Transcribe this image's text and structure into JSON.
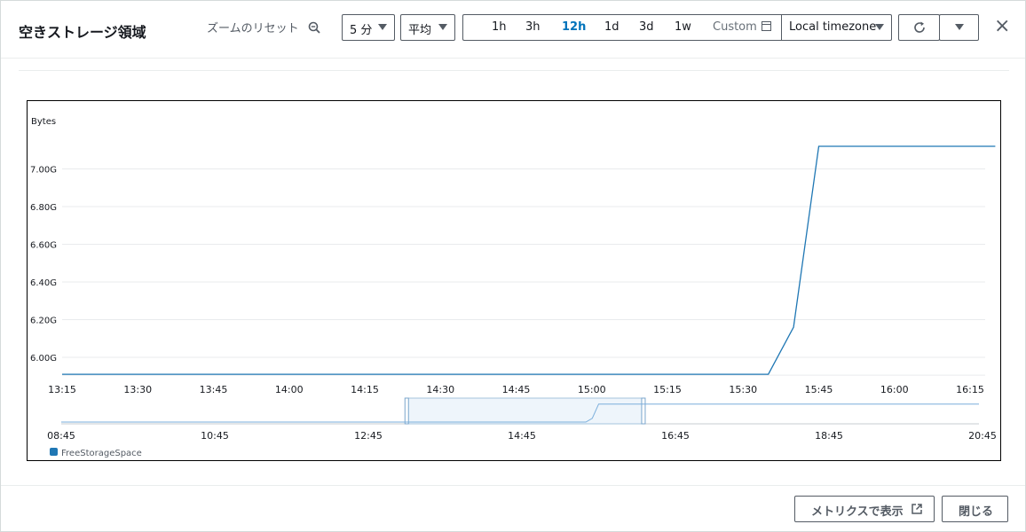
{
  "modal": {
    "title": "空きストレージ領域",
    "zoom_reset_label": "ズームのリセット",
    "period_value": "5 分",
    "statistic_value": "平均",
    "time_ranges": [
      "1h",
      "3h",
      "12h",
      "1d",
      "3d",
      "1w"
    ],
    "active_range": "12h",
    "custom_label": "Custom",
    "timezone_value": "Local timezone",
    "close_symbol": "×"
  },
  "footer": {
    "view_in_metrics_label": "メトリクスで表示",
    "close_label": "閉じる"
  },
  "chart_data": {
    "type": "line",
    "ylabel": "Bytes",
    "y_ticks": [
      "6.00G",
      "6.20G",
      "6.40G",
      "6.60G",
      "6.80G",
      "7.00G"
    ],
    "ylim": [
      5.91,
      7.28
    ],
    "x_ticks": [
      "13:15",
      "13:30",
      "13:45",
      "14:00",
      "14:15",
      "14:30",
      "14:45",
      "15:00",
      "15:15",
      "15:30",
      "15:45",
      "16:00",
      "16:15"
    ],
    "series": [
      {
        "name": "FreeStorageSpace",
        "color": "#1f77b4",
        "x": [
          "13:15",
          "15:35",
          "15:40",
          "15:45",
          "16:20"
        ],
        "values": [
          5.91,
          5.91,
          6.16,
          7.12,
          7.12
        ]
      }
    ],
    "overview": {
      "x_ticks": [
        "08:45",
        "10:45",
        "12:45",
        "14:45",
        "16:45",
        "18:45",
        "20:45"
      ],
      "selection": [
        "13:15",
        "16:20"
      ]
    },
    "grid": true,
    "legend_position": "bottom-left"
  }
}
